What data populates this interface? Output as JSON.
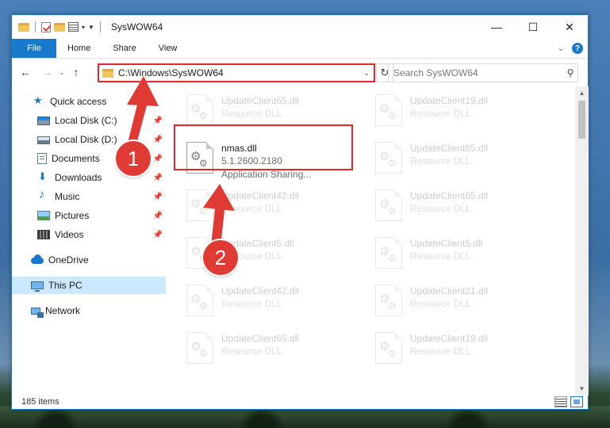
{
  "window": {
    "title": "SysWOW64",
    "controls": {
      "minimize": "—",
      "maximize": "☐",
      "close": "✕"
    }
  },
  "ribbon": {
    "tabs": [
      "File",
      "Home",
      "Share",
      "View"
    ],
    "help": "?"
  },
  "navigation": {
    "back": "←",
    "forward": "→",
    "recent": "⌄",
    "up": "↑",
    "address": "C:\\Windows\\SysWOW64",
    "search_placeholder": "Search SysWOW64"
  },
  "sidebar": {
    "items": [
      {
        "label": "Quick access",
        "icon": "star-icon",
        "pinned": false
      },
      {
        "label": "Local Disk (C:)",
        "icon": "windows-disk-icon",
        "pinned": true
      },
      {
        "label": "Local Disk (D:)",
        "icon": "disk-icon",
        "pinned": true
      },
      {
        "label": "Documents",
        "icon": "documents-icon",
        "pinned": true
      },
      {
        "label": "Downloads",
        "icon": "download-icon",
        "pinned": true
      },
      {
        "label": "Music",
        "icon": "music-icon",
        "pinned": true
      },
      {
        "label": "Pictures",
        "icon": "pictures-icon",
        "pinned": true
      },
      {
        "label": "Videos",
        "icon": "videos-icon",
        "pinned": true
      },
      {
        "label": "OneDrive",
        "icon": "onedrive-icon",
        "pinned": false
      },
      {
        "label": "This PC",
        "icon": "this-pc-icon",
        "pinned": false,
        "selected": true
      },
      {
        "label": "Network",
        "icon": "network-icon",
        "pinned": false
      }
    ]
  },
  "files": [
    {
      "name": "UpdateClient65.dll",
      "sub": "Resource DLL",
      "faded": true
    },
    {
      "name": "UpdateClient19.dll",
      "sub": "Resource DLL",
      "faded": true
    },
    {
      "name": "nmas.dll",
      "sub": "5.1.2600.2180",
      "sub2": "Application Sharing...",
      "faded": false,
      "highlighted": true
    },
    {
      "name": "UpdateClient65.dll",
      "sub": "Resource DLL",
      "faded": true
    },
    {
      "name": "UpdateClient42.dll",
      "sub": "Resource DLL",
      "faded": true
    },
    {
      "name": "UpdateClient65.dll",
      "sub": "Resource DLL",
      "faded": true
    },
    {
      "name": "UpdateClient5.dll",
      "sub": "Resource DLL",
      "faded": true
    },
    {
      "name": "UpdateClient5.dll",
      "sub": "Resource DLL",
      "faded": true
    },
    {
      "name": "UpdateClient42.dll",
      "sub": "Resource DLL",
      "faded": true
    },
    {
      "name": "UpdateClient21.dll",
      "sub": "Resource DLL",
      "faded": true
    },
    {
      "name": "UpdateClient65.dll",
      "sub": "Resource DLL",
      "faded": true
    },
    {
      "name": "UpdateClient19.dll",
      "sub": "Resource DLL",
      "faded": true
    }
  ],
  "status": {
    "item_count": "185 items"
  },
  "annotations": {
    "step1": "1",
    "step2": "2",
    "color": "#e03a34"
  }
}
